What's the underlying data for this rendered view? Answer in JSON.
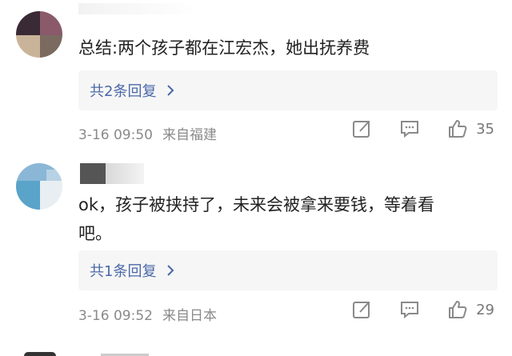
{
  "comments": [
    {
      "text": "总结:两个孩子都在江宏杰，她出抚养费",
      "replies_label": "共2条回复",
      "date": "3-16 09:50",
      "location": "来自福建",
      "likes": "35"
    },
    {
      "text": "ok，孩子被挟持了，未来会被拿来要钱，等着看吧。",
      "replies_label": "共1条回复",
      "date": "3-16 09:52",
      "location": "来自日本",
      "likes": "29"
    }
  ],
  "icons": {
    "share": "share-icon",
    "comment": "comment-icon",
    "like": "thumbs-up-icon",
    "chevron": "chevron-right-icon"
  },
  "colors": {
    "reply_link": "#4a68a8",
    "meta_text": "#8a8a8a",
    "reply_bg": "#f6f6f6"
  }
}
